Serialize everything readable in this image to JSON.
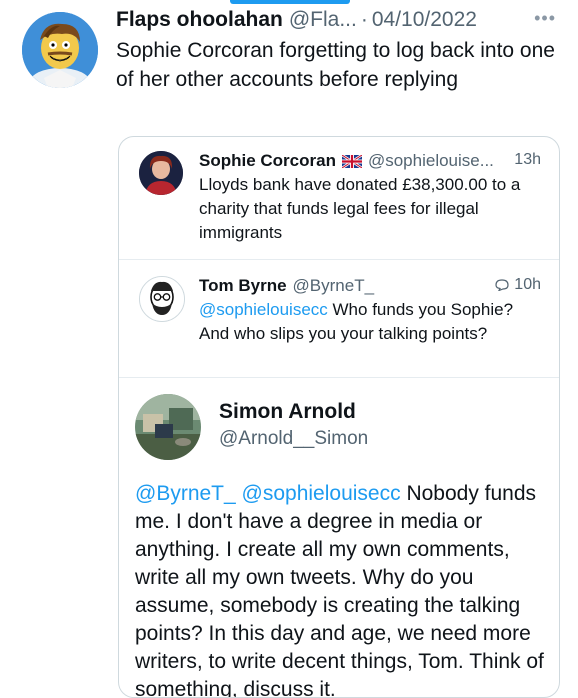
{
  "main_tweet": {
    "author_name": "Flaps ohoolahan",
    "author_handle": "@Fla...",
    "separator": "·",
    "date": "04/10/2022",
    "text": "Sophie Corcoran forgetting to log back into one of her other accounts before replying"
  },
  "replies": [
    {
      "author_name": "Sophie Corcoran",
      "author_handle": "@sophielouise...",
      "time": "13h",
      "flag_icon": "uk-flag-icon",
      "text": "Lloyds bank have donated £38,300.00 to a charity that funds legal fees for illegal immigrants"
    },
    {
      "author_name": "Tom Byrne",
      "author_handle": "@ByrneT_",
      "time": "10h",
      "meta_icon": "reply-icon",
      "mention": "@sophielouisecc",
      "text": "Who funds you Sophie? And who slips you your talking points?"
    },
    {
      "author_name": "Simon Arnold",
      "author_handle": "@Arnold__Simon",
      "mentions": "@ByrneT_ @sophielouisecc",
      "text": "Nobody funds me. I don't have a degree in media or anything. I create all my own comments, write all my own tweets. Why do you assume, somebody is creating the talking points? In this day and age, we need more writers, to write decent things, Tom. Think of something, discuss it."
    }
  ],
  "colors": {
    "accent": "#1d9bf0",
    "secondary_text": "#536471",
    "border": "#cfd9de"
  }
}
